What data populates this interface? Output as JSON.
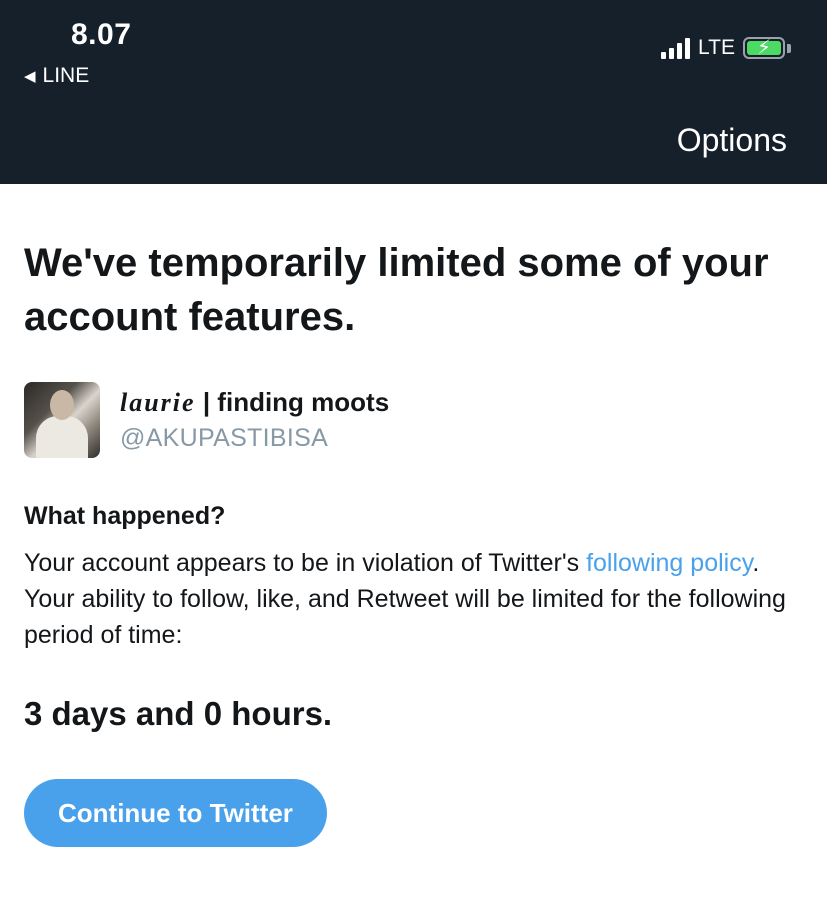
{
  "status_bar": {
    "time": "8.07",
    "back_app": "LINE",
    "network": "LTE",
    "battery_state": "charging"
  },
  "nav": {
    "options_label": "Options"
  },
  "notice": {
    "headline": "We've temporarily limited some of your account features.",
    "user": {
      "display_name_styled": "laurie",
      "display_name_rest": "| finding moots",
      "handle": "@AKUPASTIBISA"
    },
    "section_title": "What happened?",
    "body_part1": "Your account appears to be in violation of Twitter's ",
    "body_link": "following policy",
    "body_part2": ". Your ability to follow, like, and Retweet will be limited for the following period of time:",
    "duration": "3 days and 0 hours.",
    "continue_label": "Continue to Twitter"
  },
  "colors": {
    "header_bg": "#15202b",
    "accent": "#4aa1eb",
    "muted_text": "#8899a6",
    "battery_green": "#4cd964"
  }
}
